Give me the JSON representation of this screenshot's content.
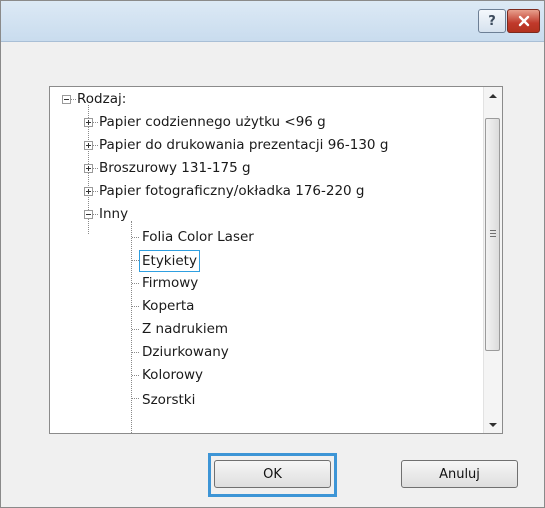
{
  "dialog": {
    "title_buttons": {
      "help_label": "?",
      "close_label": "x"
    }
  },
  "tree": {
    "root": {
      "label": "Rodzaj:",
      "expanded": true
    },
    "items": [
      {
        "label": "Papier codziennego użytku <96 g",
        "level": 1,
        "expander": "plus"
      },
      {
        "label": "Papier do drukowania prezentacji 96-130 g",
        "level": 1,
        "expander": "plus"
      },
      {
        "label": "Broszurowy 131-175 g",
        "level": 1,
        "expander": "plus"
      },
      {
        "label": "Papier fotograficzny/okładka 176-220 g",
        "level": 1,
        "expander": "plus"
      },
      {
        "label": "Inny",
        "level": 1,
        "expander": "minus"
      },
      {
        "label": "Folia Color Laser",
        "level": 2
      },
      {
        "label": "Etykiety",
        "level": 2,
        "selected": true
      },
      {
        "label": "Firmowy",
        "level": 2
      },
      {
        "label": "Koperta",
        "level": 2
      },
      {
        "label": "Z nadrukiem",
        "level": 2
      },
      {
        "label": "Dziurkowany",
        "level": 2
      },
      {
        "label": "Kolorowy",
        "level": 2
      },
      {
        "label": "Szorstki",
        "level": 2,
        "partially_visible": true
      }
    ]
  },
  "buttons": {
    "ok_label": "OK",
    "cancel_label": "Anuluj"
  },
  "colors": {
    "selection_border": "#2f9fe0",
    "focus_frame": "#3d95d6",
    "close_button": "#c0392b"
  }
}
